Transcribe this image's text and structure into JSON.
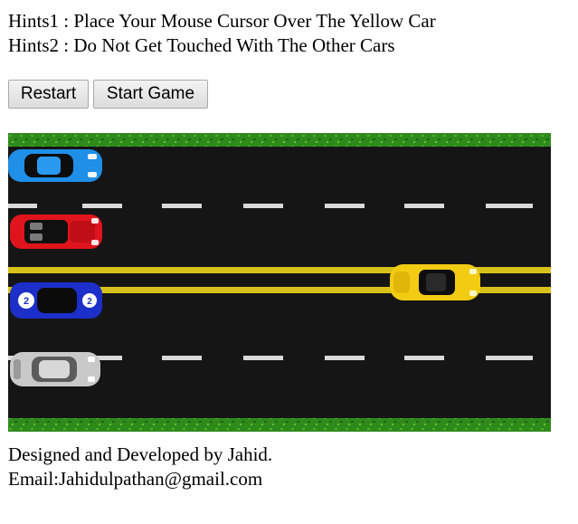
{
  "hints": {
    "hint1": "Hints1 : Place Your Mouse Cursor Over The Yellow Car",
    "hint2": "Hints2 : Do Not Get Touched With The Other Cars"
  },
  "buttons": {
    "restart": "Restart",
    "start": "Start Game"
  },
  "game": {
    "colors": {
      "grass": "#2f8a1c",
      "road": "#151515",
      "lane_dash": "#d9d9d9",
      "center_line": "#d8c21a"
    },
    "cars": [
      {
        "name": "blue-car",
        "color": "#1f8fe8"
      },
      {
        "name": "red-car",
        "color": "#e0141c"
      },
      {
        "name": "navy-race-car",
        "color": "#1c2fc8",
        "number": "2"
      },
      {
        "name": "silver-car",
        "color": "#c9c9c9"
      },
      {
        "name": "yellow-car",
        "color": "#f2cc12"
      }
    ]
  },
  "footer": {
    "credit": "Designed and Developed by Jahid.",
    "email": "Email:Jahidulpathan@gmail.com"
  }
}
